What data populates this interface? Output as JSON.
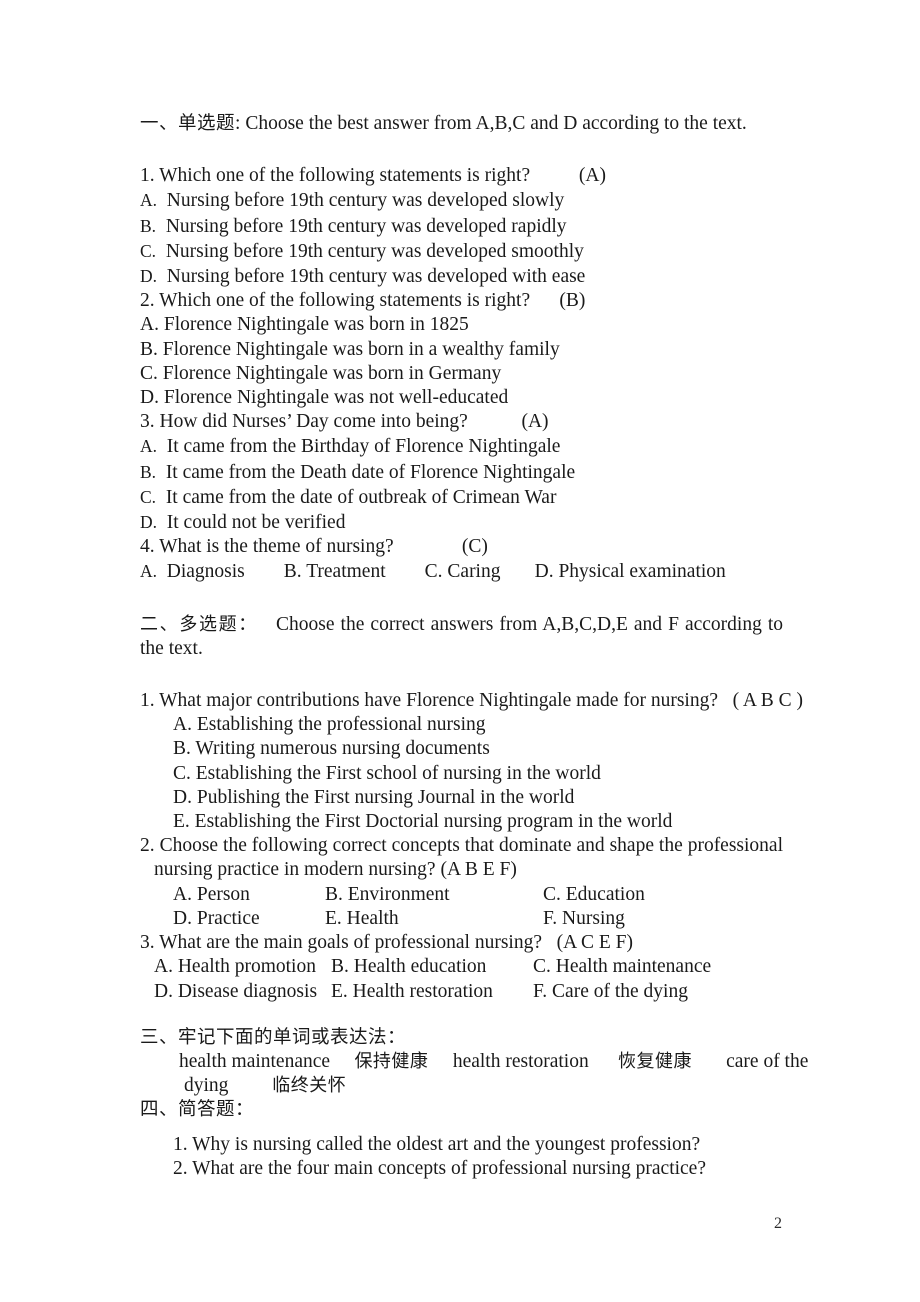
{
  "document": {
    "page_number": "2",
    "sections": [
      {
        "id": "section-one",
        "marker": "一、",
        "cjk_title": "单选题",
        "separator": ": ",
        "instruction": "Choose the best answer from A,B,C and D according to the text.",
        "questions": [
          {
            "number": "1.",
            "text": "Which one of the following statements is right?",
            "answer": "(A)",
            "options": [
              {
                "label": "A.",
                "text": "Nursing before 19th century was developed slowly"
              },
              {
                "label": "B.",
                "text": "Nursing before 19th century was developed rapidly"
              },
              {
                "label": "C.",
                "text": "Nursing before 19th century was developed smoothly"
              },
              {
                "label": "D.",
                "text": "Nursing before 19th century was developed with ease"
              }
            ]
          },
          {
            "number": "2.",
            "text": "Which one of the following statements is right?",
            "answer": "(B)",
            "options": [
              {
                "label": "A.",
                "text": "Florence Nightingale was born in 1825"
              },
              {
                "label": "B.",
                "text": "Florence Nightingale was born in a wealthy family"
              },
              {
                "label": "C.",
                "text": "Florence Nightingale was born in Germany"
              },
              {
                "label": "D.",
                "text": "Florence Nightingale was not well-educated"
              }
            ]
          },
          {
            "number": "3.",
            "text": "How did Nurses’ Day come into being?",
            "answer": "(A)",
            "options": [
              {
                "label": "A.",
                "text": "It came from the Birthday of Florence Nightingale"
              },
              {
                "label": "B.",
                "text": "It came from the Death date of Florence Nightingale"
              },
              {
                "label": "C.",
                "text": "It came from the date of outbreak of Crimean War"
              },
              {
                "label": "D.",
                "text": "It could not be verified"
              }
            ]
          },
          {
            "number": "4.",
            "text": "What is the theme of nursing?",
            "answer": "(C)",
            "inline_options": [
              {
                "label": "A.",
                "text": "Diagnosis"
              },
              {
                "label": "B.",
                "text": "Treatment"
              },
              {
                "label": "C.",
                "text": "Caring"
              },
              {
                "label": "D.",
                "text": "Physical examination"
              }
            ]
          }
        ]
      },
      {
        "id": "section-two",
        "marker": "二、",
        "cjk_title": "多选题",
        "separator": "：",
        "instruction": "Choose the correct answers from A,B,C,D,E and F according to the text.",
        "questions": [
          {
            "number": "1.",
            "text": "What major contributions have Florence Nightingale made for nursing?",
            "answer": "( A B C )",
            "options": [
              {
                "label": "A.",
                "text": "Establishing the professional nursing"
              },
              {
                "label": "B.",
                "text": "Writing numerous nursing documents"
              },
              {
                "label": "C.",
                "text": "Establishing the First school of nursing in the world"
              },
              {
                "label": "D.",
                "text": "Publishing the First nursing Journal in the world"
              },
              {
                "label": "E.",
                "text": "Establishing the First Doctorial nursing program in the world"
              }
            ]
          },
          {
            "number": "2.",
            "text": "Choose the following correct concepts that dominate and shape the professional nursing practice in modern nursing?",
            "answer": "(A B E F)",
            "grid_options": [
              {
                "label": "A.",
                "text": "Person"
              },
              {
                "label": "B.",
                "text": "Environment"
              },
              {
                "label": "C.",
                "text": "Education"
              },
              {
                "label": "D.",
                "text": "Practice"
              },
              {
                "label": "E.",
                "text": "Health"
              },
              {
                "label": "F.",
                "text": "Nursing"
              }
            ]
          },
          {
            "number": "3.",
            "text": "What are the main goals of professional nursing?",
            "answer": "(A C E F)",
            "grid_options": [
              {
                "label": "A.",
                "text": "Health promotion"
              },
              {
                "label": "B.",
                "text": "Health education"
              },
              {
                "label": "C.",
                "text": "Health maintenance"
              },
              {
                "label": "D.",
                "text": "Disease diagnosis"
              },
              {
                "label": "E.",
                "text": "Health restoration"
              },
              {
                "label": "F.",
                "text": "Care of the dying"
              }
            ]
          }
        ]
      },
      {
        "id": "section-three",
        "marker": "三、",
        "cjk_title": "牢记下面的单词或表达法",
        "separator": "：",
        "vocabulary": [
          {
            "term": "health maintenance",
            "gloss": "保持健康"
          },
          {
            "term": "health restoration",
            "gloss": "恢复健康"
          },
          {
            "term": "care of the dying",
            "gloss": "临终关怀"
          }
        ]
      },
      {
        "id": "section-four",
        "marker": "四、",
        "cjk_title": "简答题",
        "separator": "：",
        "questions": [
          {
            "number": "1.",
            "text": "Why is nursing called the oldest art and the youngest profession?"
          },
          {
            "number": "2.",
            "text": "What are the four main concepts of professional nursing practice?"
          }
        ]
      }
    ]
  }
}
